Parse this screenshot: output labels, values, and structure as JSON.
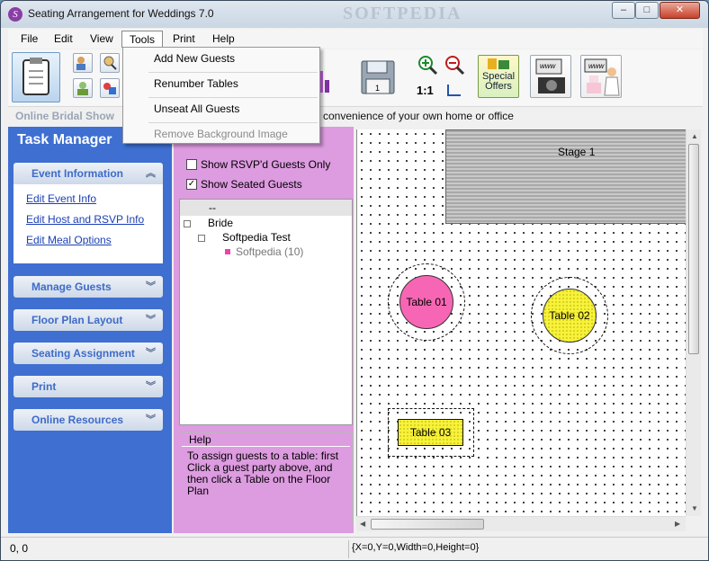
{
  "window": {
    "title": "Seating Arrangement for Weddings 7.0",
    "watermark": "SOFTPEDIA",
    "controls": {
      "minimize": "–",
      "maximize": "□",
      "close": "✕"
    }
  },
  "menu": {
    "items": [
      "File",
      "Edit",
      "View",
      "Tools",
      "Print",
      "Help"
    ],
    "open": "Tools"
  },
  "tools_menu": {
    "items": [
      {
        "label": "Add New Guests",
        "enabled": true
      },
      {
        "label": "Renumber Tables",
        "enabled": true
      },
      {
        "label": "Unseat All Guests",
        "enabled": true
      },
      {
        "label": "Remove Background Image",
        "enabled": false
      }
    ]
  },
  "toolbar": {
    "special_offers": "Special\nOffers",
    "www1": "www",
    "www2": "www",
    "zoom_label": "1:1",
    "save_badge": "1"
  },
  "banner": {
    "left": "Online Bridal Show",
    "right": "convenience of your own home or office"
  },
  "task_pane": {
    "title": "Task Manager",
    "sections": [
      {
        "label": "Event Information",
        "expanded": true
      },
      {
        "label": "Manage Guests",
        "expanded": false
      },
      {
        "label": "Floor Plan Layout",
        "expanded": false
      },
      {
        "label": "Seating Assignment",
        "expanded": false
      },
      {
        "label": "Print",
        "expanded": false
      },
      {
        "label": "Online Resources",
        "expanded": false
      }
    ],
    "links": [
      "Edit Event Info",
      "Edit Host and RSVP Info",
      "Edit Meal Options"
    ]
  },
  "guests": {
    "show_rsvp": {
      "label": "Show RSVP'd Guests Only",
      "checked": false
    },
    "show_seated": {
      "label": "Show Seated Guests",
      "checked": true
    },
    "tree_header": "--",
    "tree": [
      {
        "label": "Bride",
        "level": 0
      },
      {
        "label": "Softpedia Test",
        "level": 1
      },
      {
        "label": "Softpedia (10)",
        "level": 2
      }
    ]
  },
  "help": {
    "title": "Help",
    "text": "To assign guests to a table: first Click a guest party above, and then click a Table on the Floor Plan"
  },
  "floor": {
    "stage": "Stage 1",
    "tables": [
      {
        "label": "Table 01",
        "color": "#f766b4"
      },
      {
        "label": "Table 02",
        "color": "#f7f23a"
      },
      {
        "label": "Table 03",
        "color": "#f7f23a"
      }
    ]
  },
  "status": {
    "coords": "0, 0",
    "selection": "{X=0,Y=0,Width=0,Height=0}"
  },
  "colors": {
    "task_blue": "#3e6fd1",
    "guest_pink": "#dd9be0",
    "menu_bg": "#f9f9f9"
  }
}
